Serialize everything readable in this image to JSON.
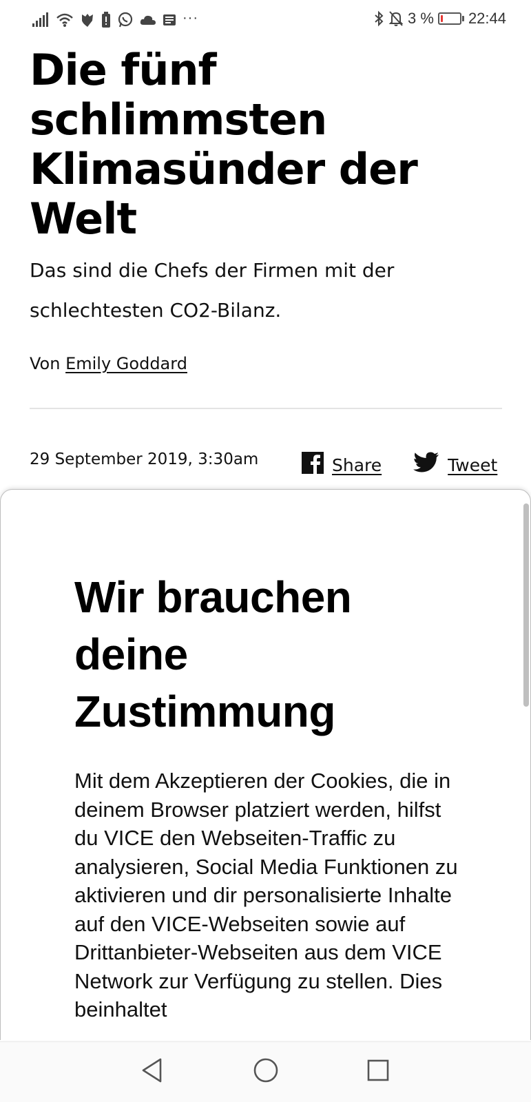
{
  "status_bar": {
    "battery_percent": "3 %",
    "battery_level": 0.03,
    "time": "22:44",
    "left_icons": [
      "signal-icon",
      "wifi-icon",
      "shield-icon",
      "battery-alert-icon",
      "whatsapp-icon",
      "cloud-icon",
      "news-icon",
      "more-dots-icon"
    ],
    "more_dots": "···",
    "right_icons": [
      "bluetooth-icon",
      "bell-off-icon"
    ]
  },
  "article": {
    "title": "Die fünf schlimmsten Klimasünder der Welt",
    "subtitle": "Das sind die Chefs der Firmen mit der schlechtesten CO2-Bilanz.",
    "byline_prefix": "Von",
    "author": "Emily Goddard",
    "date": "29 September 2019, 3:30am",
    "share_label": "Share",
    "tweet_label": "Tweet"
  },
  "consent_modal": {
    "title": "Wir brauchen deine Zustimmung",
    "body": "Mit dem Akzeptieren der Cookies, die in deinem Browser platziert werden, hilfst du VICE den Webseiten-Traffic zu analysieren, Social Media Funktionen zu aktivieren und dir personalisierte Inhalte auf den VICE-Webseiten sowie auf Drittanbieter-Webseiten aus dem VICE Network zur Verfügung zu stellen. Dies beinhaltet"
  },
  "navigation_bar": {
    "buttons": [
      "back-icon",
      "home-icon",
      "recents-icon"
    ]
  },
  "colors": {
    "text": "#000000",
    "divider": "#e3e3e3",
    "battery_low": "#e53935",
    "background": "#ffffff"
  }
}
